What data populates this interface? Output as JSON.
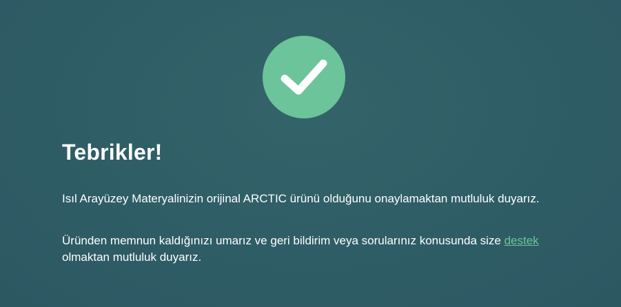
{
  "colors": {
    "background": "#2f5e66",
    "accent": "#6cc49a",
    "text": "#ffffff"
  },
  "status_icon": "check-circle-icon",
  "title": "Tebrikler!",
  "message_1": "Isıl Arayüzey Materyalinizin orijinal ARCTIC ürünü olduğunu onaylamaktan mutluluk duyarız.",
  "message_2": {
    "before_link": "Üründen memnun kaldığınızı umarız ve geri bildirim veya sorularınız konusunda size ",
    "link_text": "destek",
    "after_link": " olmaktan mutluluk duyarız."
  }
}
